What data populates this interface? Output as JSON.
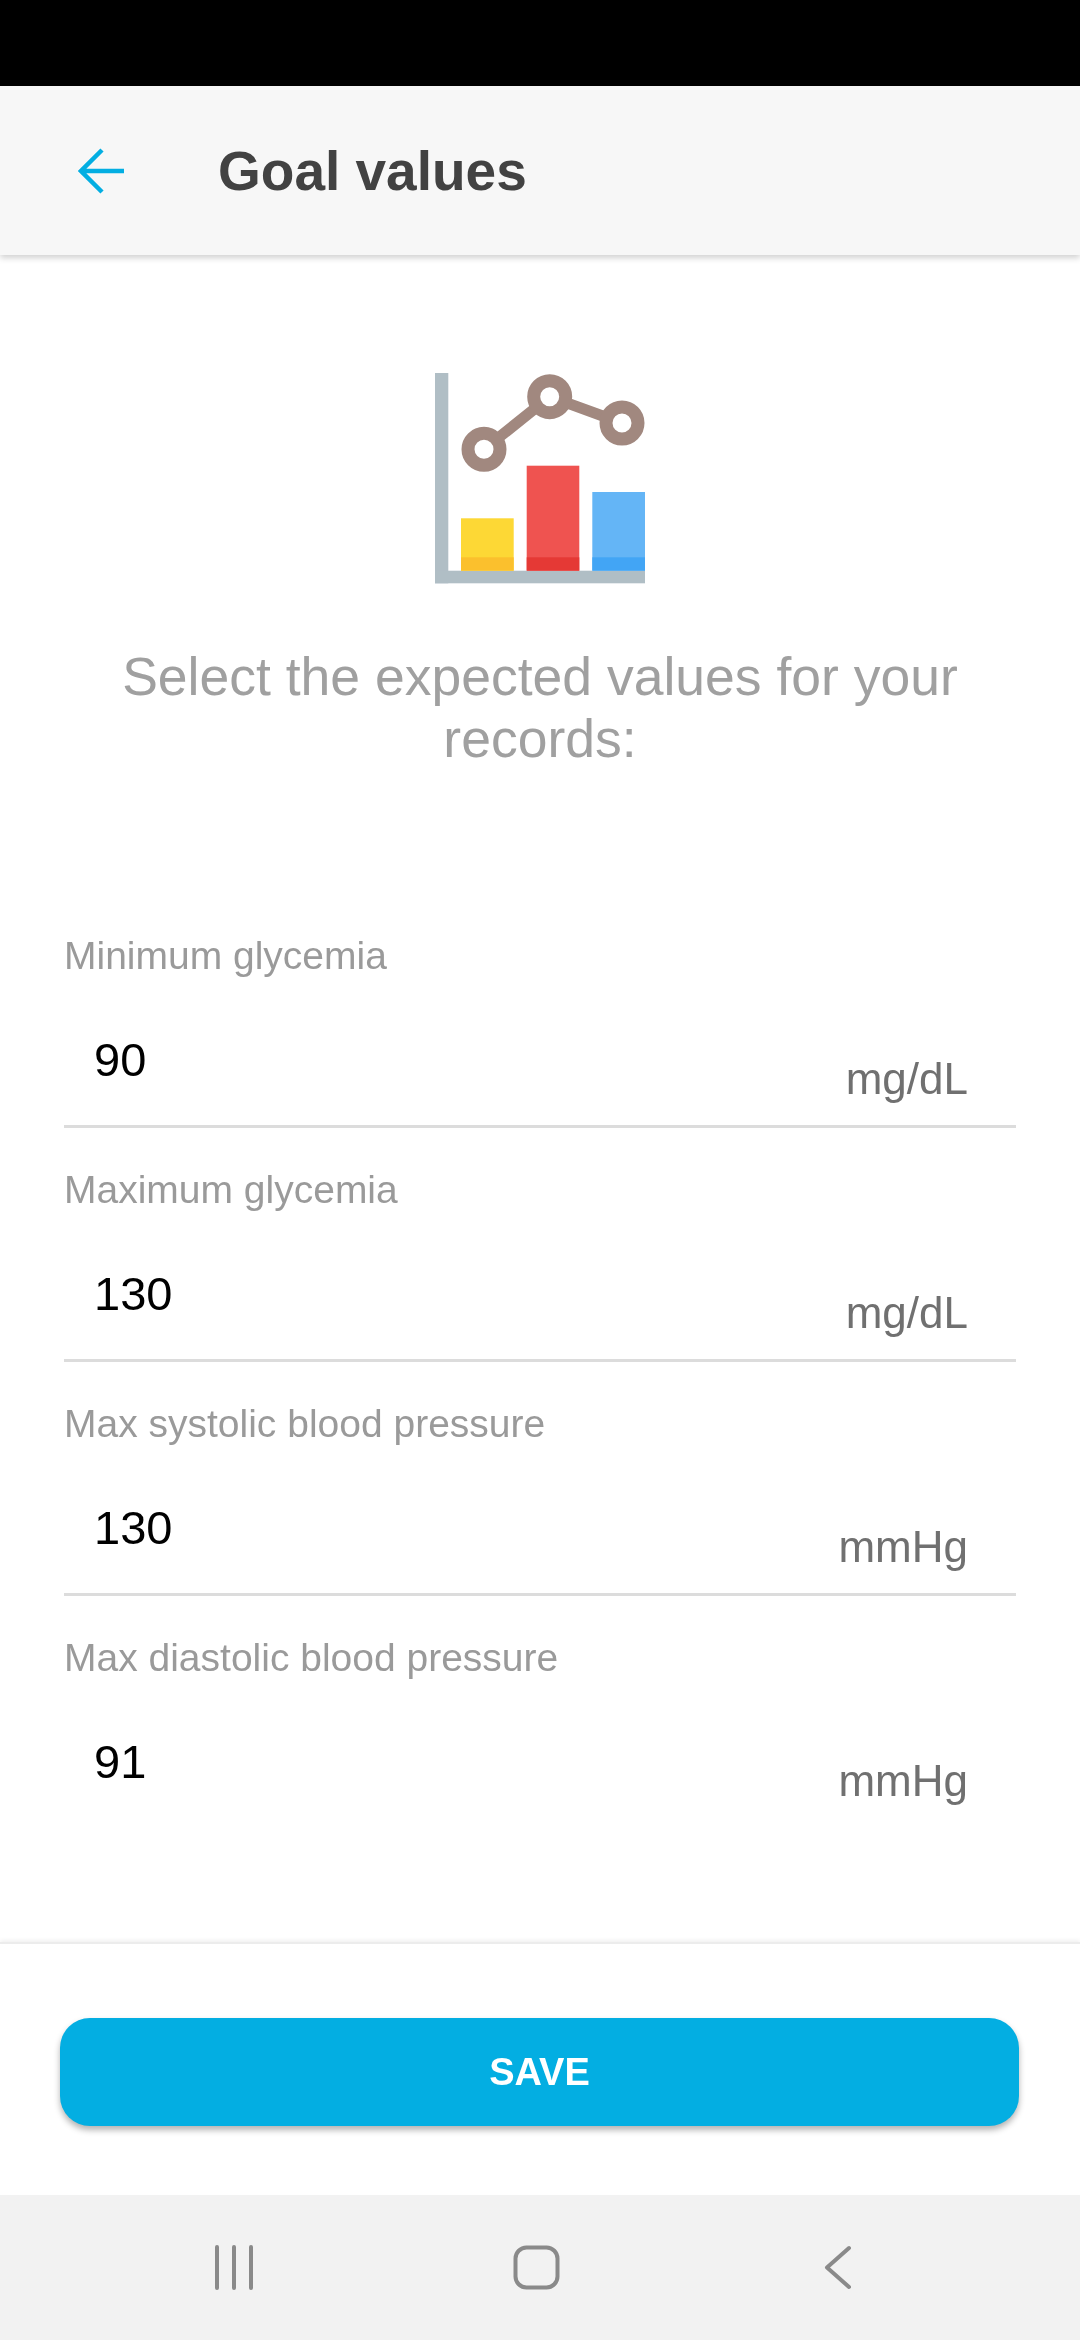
{
  "app_bar": {
    "title": "Goal values"
  },
  "intro": "Select the expected values for your records:",
  "fields": [
    {
      "label": "Minimum glycemia",
      "value": "90",
      "unit": "mg/dL"
    },
    {
      "label": "Maximum glycemia",
      "value": "130",
      "unit": "mg/dL"
    },
    {
      "label": "Max systolic blood pressure",
      "value": "130",
      "unit": "mmHg"
    },
    {
      "label": "Max diastolic blood pressure",
      "value": "91",
      "unit": "mmHg"
    }
  ],
  "save_button": {
    "label": "SAVE"
  }
}
